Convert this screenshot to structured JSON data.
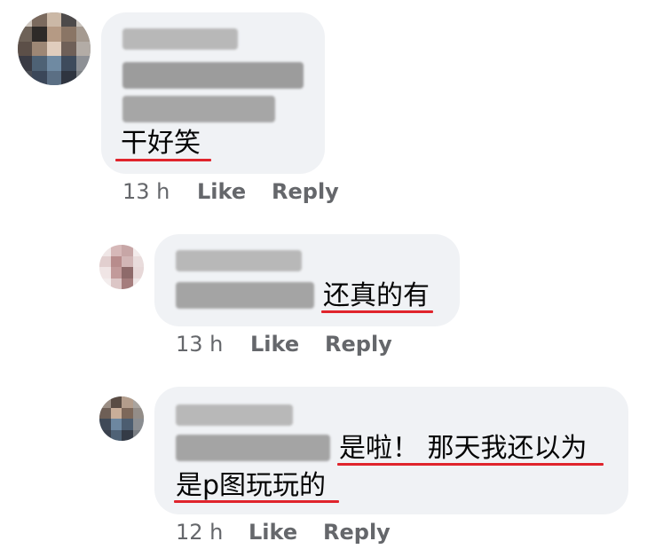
{
  "comments": [
    {
      "text_lines": [
        "干好笑"
      ],
      "time": "13 h",
      "like_label": "Like",
      "reply_label": "Reply"
    },
    {
      "text_lines": [
        "还真的有"
      ],
      "time": "13 h",
      "like_label": "Like",
      "reply_label": "Reply"
    },
    {
      "text_lines": [
        "是啦！ 那天我还以为",
        "是p图玩玩的"
      ],
      "time": "12 h",
      "like_label": "Like",
      "reply_label": "Reply"
    }
  ],
  "colors": {
    "bubble_bg": "#f0f2f5",
    "meta_text": "#65676b",
    "underline": "#e0242c"
  }
}
